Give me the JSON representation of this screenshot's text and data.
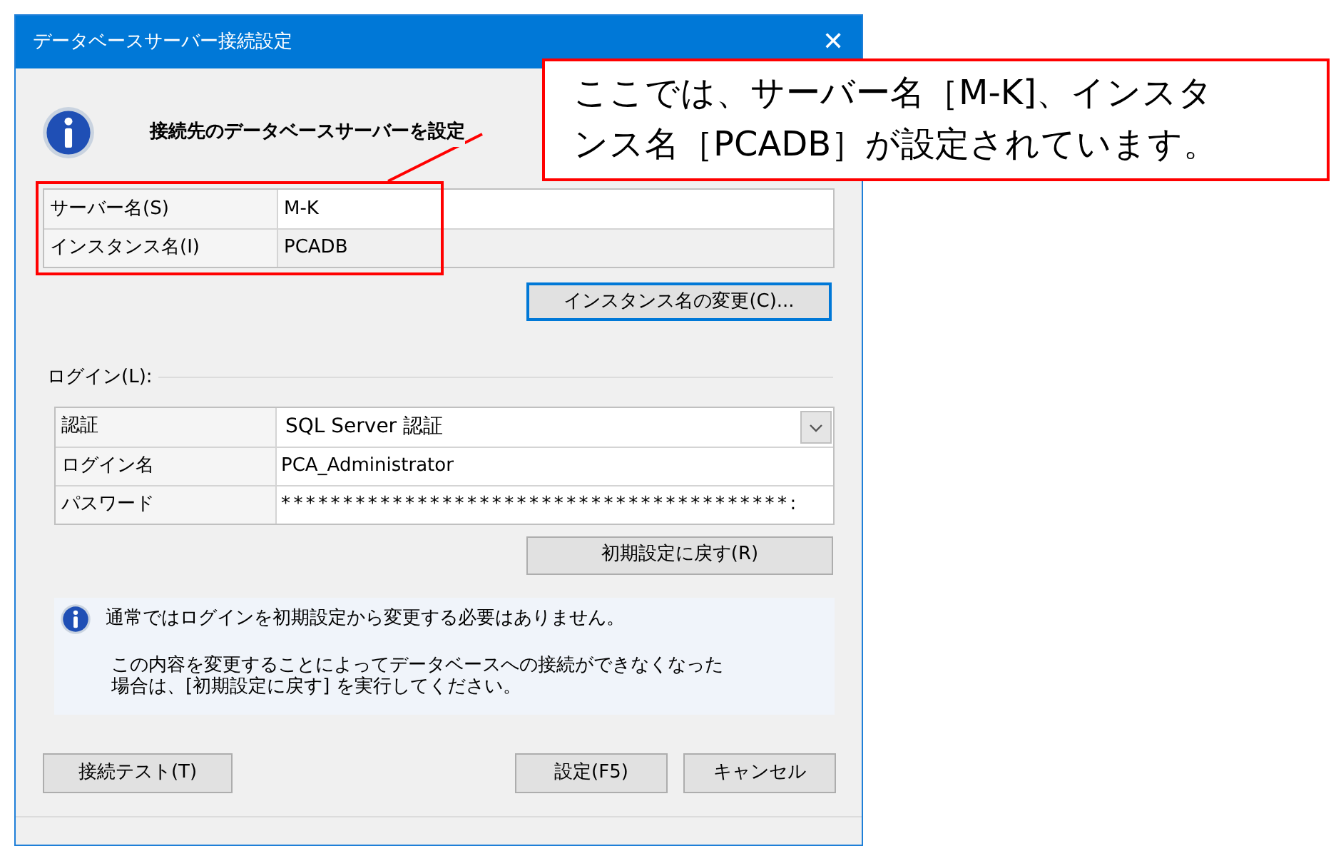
{
  "window": {
    "title": "データベースサーバー接続設定",
    "close": "✕"
  },
  "heading": "接続先のデータベースサーバーを設定",
  "server_table": [
    {
      "label": "サーバー名(S)",
      "value": "M-K"
    },
    {
      "label": "インスタンス名(I)",
      "value": "PCADB"
    }
  ],
  "change_instance_button": {
    "label": "インスタンス名の変更(C)...",
    "focused": true
  },
  "login": {
    "label": "ログイン(L):",
    "rows": [
      {
        "kind": "dropdown",
        "label": "認証",
        "value": "SQL Server 認証"
      },
      {
        "kind": "text",
        "label": "ログイン名",
        "value": "PCA_Administrator"
      },
      {
        "kind": "text",
        "label": "パスワード",
        "value": "*****************************************:"
      }
    ]
  },
  "reset_button": "初期設定に戻す(R)",
  "info": {
    "main": "通常ではログインを初期設定から変更する必要はありません。",
    "detail": [
      "この内容を変更することによってデータベースへの接続ができなくなった",
      "場合は、[初期設定に戻す] を実行してください。"
    ]
  },
  "footer_left_buttons": [
    "接続テスト(T)"
  ],
  "footer_right_buttons": [
    "設定(F5)",
    "キャンセル"
  ],
  "callout": {
    "lines": [
      "ここでは、サーバー名［M-K]、インスタ",
      "ンス名［PCADB］が設定されています。"
    ]
  }
}
